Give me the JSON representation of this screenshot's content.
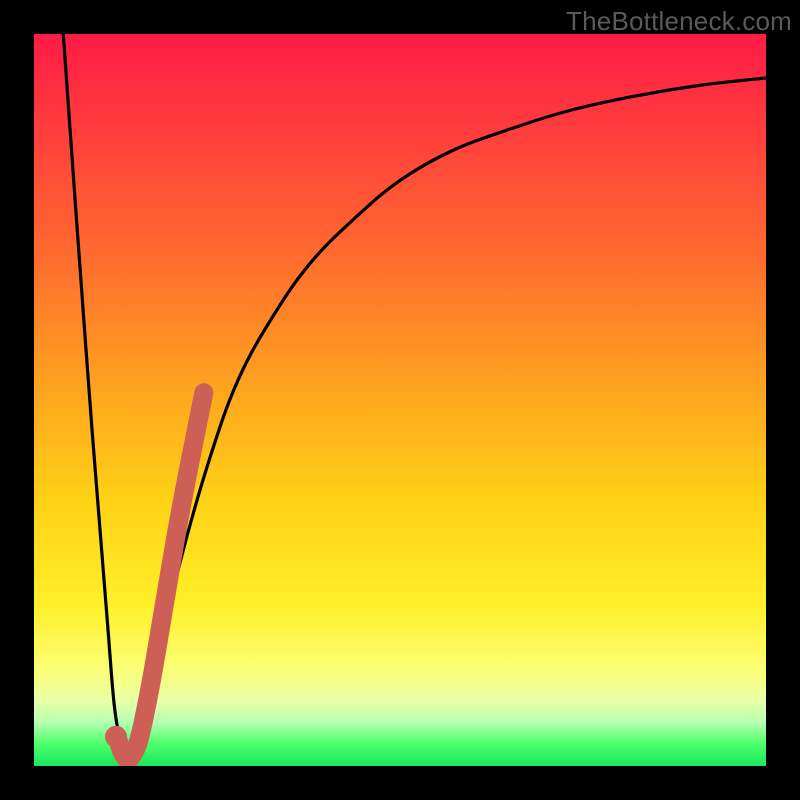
{
  "watermark": "TheBottleneck.com",
  "chart_data": {
    "type": "line",
    "title": "",
    "xlabel": "",
    "ylabel": "",
    "xlim": [
      0,
      100
    ],
    "ylim": [
      0,
      100
    ],
    "series": [
      {
        "name": "bottleneck-curve",
        "x": [
          4,
          6,
          8,
          10,
          11,
          12,
          13,
          14,
          15,
          17,
          20,
          24,
          28,
          33,
          38,
          44,
          50,
          57,
          65,
          73,
          82,
          91,
          100
        ],
        "values": [
          100,
          72,
          45,
          20,
          8,
          3,
          1,
          2,
          6,
          15,
          28,
          42,
          53,
          62,
          69,
          75,
          80,
          84,
          87,
          89.5,
          91.5,
          93,
          94
        ]
      },
      {
        "name": "highlight-segment",
        "x": [
          11.5,
          12.0,
          12.7,
          13.5,
          14.5,
          16.0,
          17.8,
          19.5,
          21.0,
          22.3,
          23.2
        ],
        "values": [
          3.5,
          2.0,
          1.0,
          1.6,
          4.2,
          11.5,
          22.0,
          32.0,
          40.0,
          46.5,
          51.0
        ]
      }
    ],
    "annotations": []
  }
}
